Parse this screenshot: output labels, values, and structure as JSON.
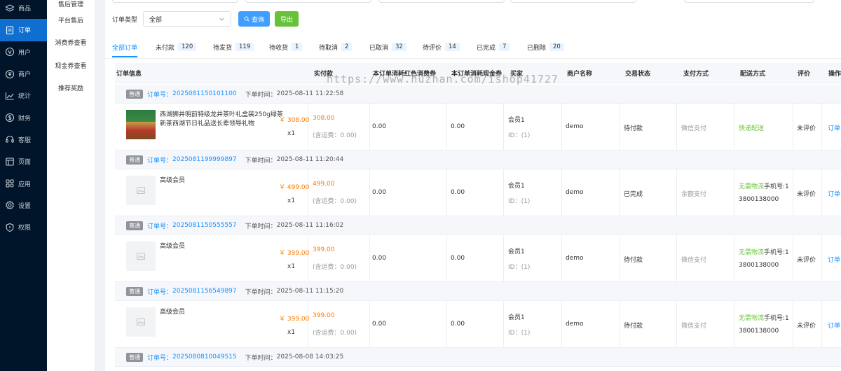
{
  "sidebar": {
    "items": [
      {
        "label": "商品",
        "icon": "layers-icon",
        "active": false
      },
      {
        "label": "订单",
        "icon": "order-icon",
        "active": true
      },
      {
        "label": "用户",
        "icon": "user-v-icon",
        "active": false
      },
      {
        "label": "商户",
        "icon": "merchant-icon",
        "active": false
      },
      {
        "label": "统计",
        "icon": "chart-icon",
        "active": false
      },
      {
        "label": "财务",
        "icon": "finance-icon",
        "active": false
      },
      {
        "label": "客服",
        "icon": "headset-icon",
        "active": false
      },
      {
        "label": "页面",
        "icon": "page-icon",
        "active": false
      },
      {
        "label": "应用",
        "icon": "apps-icon",
        "active": false
      },
      {
        "label": "设置",
        "icon": "gear-icon",
        "active": false
      },
      {
        "label": "权限",
        "icon": "shield-icon",
        "active": false
      }
    ]
  },
  "submenu": {
    "items": [
      "售后管理",
      "平台售后",
      "消费券查看",
      "现金券查看",
      "推荐奖励"
    ]
  },
  "filter": {
    "label": "订单类型",
    "select_value": "全部",
    "query_label": "查询",
    "export_label": "导出"
  },
  "tabs": [
    {
      "label": "全部订单",
      "count": "",
      "active": true
    },
    {
      "label": "未付款",
      "count": "120"
    },
    {
      "label": "待发货",
      "count": "119"
    },
    {
      "label": "待收货",
      "count": "1"
    },
    {
      "label": "待取消",
      "count": "2"
    },
    {
      "label": "已取消",
      "count": "32"
    },
    {
      "label": "待评价",
      "count": "14"
    },
    {
      "label": "已完成",
      "count": "7"
    },
    {
      "label": "已删除",
      "count": "20"
    }
  ],
  "table": {
    "headers": [
      "订单信息",
      "实付款",
      "本订单消耗红色消费券",
      "本订单消耗现金券",
      "买家",
      "商户名称",
      "交易状态",
      "支付方式",
      "配送方式",
      "评价",
      "操作"
    ]
  },
  "watermark": "https://www.huzhan.com/ishop41727",
  "orders": [
    {
      "tag": "普通",
      "order_no_label": "订单号：",
      "order_no": "2025081150101100",
      "time_label": "下单时间：",
      "time": "2025-08-11 11:22:58",
      "product": "西湖狮井明前特级龙井茶叶礼盒装250g绿茶新茶西湖节日礼品送长辈领导礼物",
      "unit_price": "￥ 308.00",
      "qty": "x1",
      "paid": "308.00",
      "shipping": "(含运费：0.00)",
      "red_voucher": "0.00",
      "cash_voucher": "0.00",
      "buyer": "会员1",
      "buyer_id": "ID：(1)",
      "merchant": "demo",
      "status": "待付款",
      "pay_method": "微信支付",
      "delivery": "快递配送",
      "delivery_extra": "",
      "phone": "",
      "rating": "未评价",
      "action": "订单",
      "thumb": "tea"
    },
    {
      "tag": "普通",
      "order_no_label": "订单号：",
      "order_no": "2025081199999897",
      "time_label": "下单时间：",
      "time": "2025-08-11 11:20:44",
      "product": "高级会员",
      "unit_price": "￥ 499.00",
      "qty": "x1",
      "paid": "499.00",
      "shipping": "(含运费：0.00)",
      "red_voucher": "0.00",
      "cash_voucher": "0.00",
      "buyer": "会员1",
      "buyer_id": "ID：(1)",
      "merchant": "demo",
      "status": "已完成",
      "pay_method": "余额支付",
      "delivery": "无需物流",
      "delivery_extra": "手机号:1",
      "phone": "3800138000",
      "rating": "未评价",
      "action": "订单",
      "thumb": "placeholder"
    },
    {
      "tag": "普通",
      "order_no_label": "订单号：",
      "order_no": "2025081150555557",
      "time_label": "下单时间：",
      "time": "2025-08-11 11:16:02",
      "product": "高级会员",
      "unit_price": "￥ 399.00",
      "qty": "x1",
      "paid": "399.00",
      "shipping": "(含运费：0.00)",
      "red_voucher": "0.00",
      "cash_voucher": "0.00",
      "buyer": "会员1",
      "buyer_id": "ID：(1)",
      "merchant": "demo",
      "status": "待付款",
      "pay_method": "微信支付",
      "delivery": "无需物流",
      "delivery_extra": "手机号:1",
      "phone": "3800138000",
      "rating": "未评价",
      "action": "订单",
      "thumb": "placeholder"
    },
    {
      "tag": "普通",
      "order_no_label": "订单号：",
      "order_no": "2025081156549897",
      "time_label": "下单时间：",
      "time": "2025-08-11 11:15:20",
      "product": "高级会员",
      "unit_price": "￥ 399.00",
      "qty": "x1",
      "paid": "399.00",
      "shipping": "(含运费：0.00)",
      "red_voucher": "0.00",
      "cash_voucher": "0.00",
      "buyer": "会员1",
      "buyer_id": "ID：(1)",
      "merchant": "demo",
      "status": "待付款",
      "pay_method": "微信支付",
      "delivery": "无需物流",
      "delivery_extra": "手机号:1",
      "phone": "3800138000",
      "rating": "未评价",
      "action": "订单",
      "thumb": "placeholder"
    },
    {
      "tag": "普通",
      "order_no_label": "订单号：",
      "order_no": "2025080810049515",
      "time_label": "下单时间：",
      "time": "2025-08-08 14:03:25"
    }
  ]
}
